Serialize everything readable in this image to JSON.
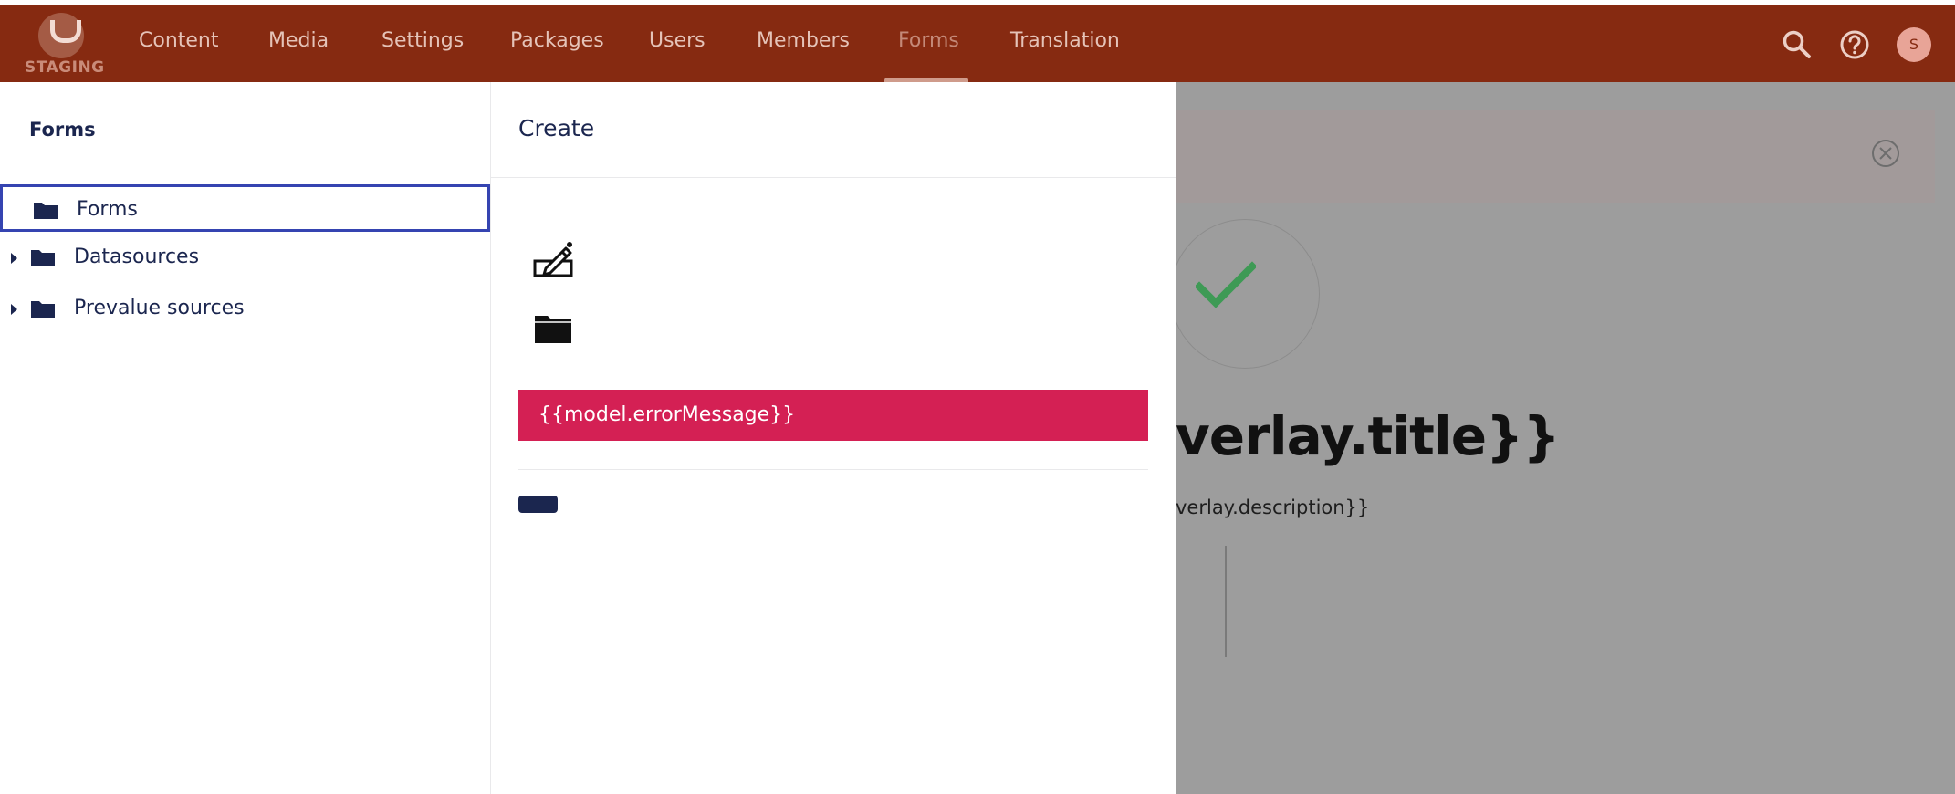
{
  "header": {
    "logo_text": "STAGING",
    "nav": [
      "Content",
      "Media",
      "Settings",
      "Packages",
      "Users",
      "Members",
      "Forms",
      "Translation"
    ],
    "active_nav": "Forms",
    "user_initial": "S",
    "colors": {
      "bar": "#862a11",
      "nav_text": "#e5c3b8",
      "active_text": "#c48978"
    },
    "icons": [
      "search-icon",
      "help-icon",
      "avatar"
    ]
  },
  "tree": {
    "title": "Forms",
    "items": [
      {
        "label": "Forms",
        "selected": true,
        "expandable": false
      },
      {
        "label": "Datasources",
        "selected": false,
        "expandable": true
      },
      {
        "label": "Prevalue sources",
        "selected": false,
        "expandable": true
      }
    ]
  },
  "create": {
    "title": "Create",
    "options_icons": [
      "edit-form-icon",
      "folder-icon"
    ],
    "error_message": "{{model.errorMessage}}",
    "colors": {
      "error": "#d42054",
      "button": "#1b264f"
    }
  },
  "background": {
    "title": "verlay.title}}",
    "description": "verlay.description}}",
    "colors": {
      "check": "#3e9a55"
    }
  }
}
